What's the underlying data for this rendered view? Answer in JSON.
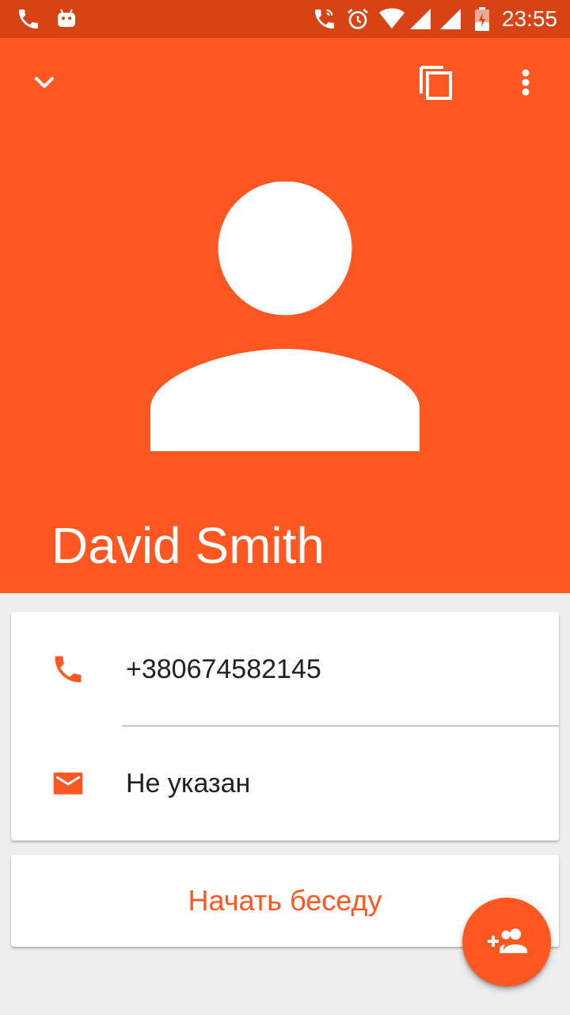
{
  "status_bar": {
    "time": "23:55",
    "icons": [
      "phone-icon",
      "android-icon",
      "wifi-calling-icon",
      "alarm-icon",
      "wifi-icon",
      "signal-icon",
      "signal-icon",
      "battery-charging-icon"
    ]
  },
  "header": {
    "collapse_icon": "chevron-down-icon",
    "copy_icon": "copy-icon",
    "more_icon": "more-vert-icon",
    "avatar_icon": "person-icon",
    "contact_name": "David Smith"
  },
  "details": {
    "phone": {
      "icon": "phone-icon",
      "value": "+380674582145"
    },
    "email": {
      "icon": "email-icon",
      "value": "Не указан"
    }
  },
  "actions": {
    "start_conversation": "Начать беседу"
  },
  "fab": {
    "icon": "add-group-icon"
  },
  "colors": {
    "status_bar": "#d84315",
    "accent": "#ff5722",
    "background": "#eeeeee",
    "card": "#ffffff",
    "text": "#212121"
  }
}
